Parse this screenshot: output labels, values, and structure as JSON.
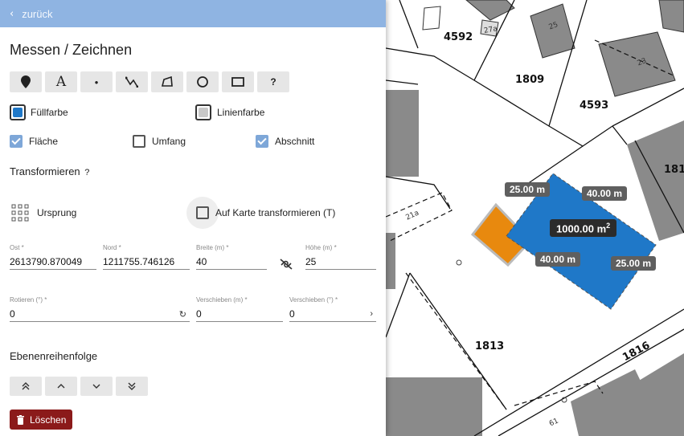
{
  "header": {
    "back_label": "zurück"
  },
  "title": "Messen / Zeichnen",
  "tools": [
    {
      "name": "marker-tool-button",
      "icon": "map-pin-icon",
      "glyph": ""
    },
    {
      "name": "text-tool-button",
      "icon": "text-icon",
      "glyph": "A"
    },
    {
      "name": "point-tool-button",
      "icon": "point-icon",
      "glyph": "•"
    },
    {
      "name": "line-tool-button",
      "icon": "polyline-icon",
      "glyph": ""
    },
    {
      "name": "polygon-tool-button",
      "icon": "polygon-icon",
      "glyph": ""
    },
    {
      "name": "circle-tool-button",
      "icon": "circle-icon",
      "glyph": ""
    },
    {
      "name": "rectangle-tool-button",
      "icon": "rectangle-icon",
      "glyph": ""
    },
    {
      "name": "help-tool-button",
      "icon": "help-icon",
      "glyph": "?"
    }
  ],
  "colors": {
    "fill_label": "Füllfarbe",
    "fill_color": "#1f78c8",
    "line_label": "Linienfarbe",
    "line_color": "#c8c8c8"
  },
  "checks": {
    "area": {
      "label": "Fläche",
      "checked": true
    },
    "perimeter": {
      "label": "Umfang",
      "checked": false
    },
    "segment": {
      "label": "Abschnitt",
      "checked": true
    }
  },
  "transform": {
    "title": "Transformieren",
    "help": "?",
    "origin_label": "Ursprung",
    "on_map_label": "Auf Karte transformieren (T)",
    "fields": {
      "east_label": "Ost *",
      "east_value": "2613790.870049",
      "north_label": "Nord *",
      "north_value": "1211755.746126",
      "width_label": "Breite (m) *",
      "width_value": "40",
      "height_label": "Höhe (m) *",
      "height_value": "25",
      "rotate_label": "Rotieren (°) *",
      "rotate_value": "0",
      "shift_m_label": "Verschieben (m) *",
      "shift_m_value": "0",
      "shift_deg_label": "Verschieben (°) *",
      "shift_deg_value": "0"
    }
  },
  "order": {
    "title": "Ebenenreihenfolge",
    "buttons": [
      "«",
      "‹",
      "›",
      "»"
    ]
  },
  "delete_label": "Löschen",
  "map": {
    "parcels": [
      "4592",
      "1809",
      "4593",
      "181",
      "1813",
      "1816"
    ],
    "house_numbers": [
      "27a",
      "25",
      "23",
      "21a",
      "61"
    ],
    "measurements": {
      "top_left": "25.00 m",
      "top_right": "40.00 m",
      "area_value": "1000.00 m",
      "area_sup": "2",
      "bottom_left": "40.00 m",
      "bottom_right": "25.00 m"
    },
    "rect_fill": "#1f78c8",
    "orange_fill": "#e8890e"
  }
}
